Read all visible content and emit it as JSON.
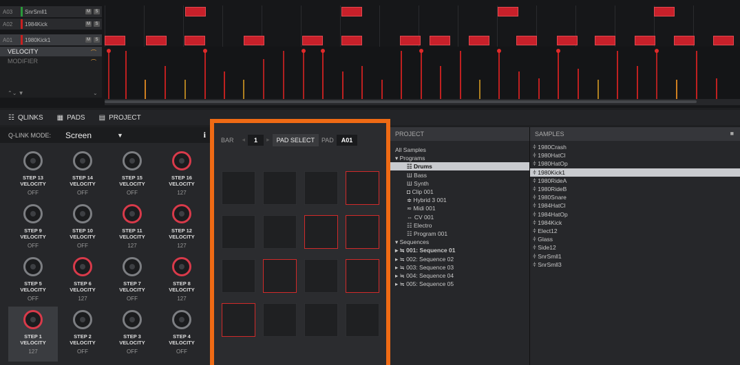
{
  "tracks": [
    {
      "id": "A03",
      "name": "SnrSmll1",
      "color": "#2a9a3a",
      "m": "M",
      "s": "S"
    },
    {
      "id": "A02",
      "name": "1984Kick",
      "color": "#c82020",
      "m": "M",
      "s": "S"
    },
    {
      "id": "A01",
      "name": "1980Kick1",
      "color": "#c82020",
      "m": "M",
      "s": "S"
    }
  ],
  "velocity_panel": {
    "velocity": "VELOCITY",
    "modifier": "MODIFIER",
    "bottom_left": "⌃⌄ ▼",
    "bottom_mid": "⌄"
  },
  "tabs": [
    {
      "label": "QLINKS",
      "icon": "sliders-icon"
    },
    {
      "label": "PADS",
      "icon": "pads-grid-icon"
    },
    {
      "label": "PROJECT",
      "icon": "project-icon"
    }
  ],
  "qlink": {
    "mode_label": "Q-LINK MODE:",
    "mode_value": "Screen",
    "arrow": "▼",
    "info": "i",
    "knobs": [
      {
        "title": "STEP 13",
        "sub": "VELOCITY",
        "value": "OFF",
        "active": false
      },
      {
        "title": "STEP 14",
        "sub": "VELOCITY",
        "value": "OFF",
        "active": false
      },
      {
        "title": "STEP 15",
        "sub": "VELOCITY",
        "value": "OFF",
        "active": false
      },
      {
        "title": "STEP 16",
        "sub": "VELOCITY",
        "value": "127",
        "active": true
      },
      {
        "title": "STEP 9",
        "sub": "VELOCITY",
        "value": "OFF",
        "active": false
      },
      {
        "title": "STEP 10",
        "sub": "VELOCITY",
        "value": "OFF",
        "active": false
      },
      {
        "title": "STEP 11",
        "sub": "VELOCITY",
        "value": "127",
        "active": true
      },
      {
        "title": "STEP 12",
        "sub": "VELOCITY",
        "value": "127",
        "active": true
      },
      {
        "title": "STEP 5",
        "sub": "VELOCITY",
        "value": "OFF",
        "active": false
      },
      {
        "title": "STEP 6",
        "sub": "VELOCITY",
        "value": "127",
        "active": true
      },
      {
        "title": "STEP 7",
        "sub": "VELOCITY",
        "value": "OFF",
        "active": false
      },
      {
        "title": "STEP 8",
        "sub": "VELOCITY",
        "value": "127",
        "active": true
      },
      {
        "title": "STEP 1",
        "sub": "VELOCITY",
        "value": "127",
        "active": true
      },
      {
        "title": "STEP 2",
        "sub": "VELOCITY",
        "value": "OFF",
        "active": false
      },
      {
        "title": "STEP 3",
        "sub": "VELOCITY",
        "value": "OFF",
        "active": false
      },
      {
        "title": "STEP 4",
        "sub": "VELOCITY",
        "value": "OFF",
        "active": false
      }
    ]
  },
  "pads": {
    "bar_label": "BAR",
    "bar_value": "1",
    "pad_select": "PAD SELECT",
    "pad_label": "PAD",
    "pad_value": "A01",
    "lit": [
      false,
      false,
      false,
      true,
      false,
      false,
      true,
      true,
      false,
      true,
      false,
      true,
      true,
      false,
      false,
      false
    ]
  },
  "project": {
    "header": "PROJECT",
    "items": [
      {
        "text": "All Samples",
        "indent": 0
      },
      {
        "text": "▾ Programs",
        "indent": 0
      },
      {
        "text": "☷ Drums",
        "indent": 1,
        "selected": true
      },
      {
        "text": "Ш Bass",
        "indent": 1
      },
      {
        "text": "Ш Synth",
        "indent": 1
      },
      {
        "text": "◘ Clip 001",
        "indent": 1
      },
      {
        "text": "≑ Hybrid 3 001",
        "indent": 1
      },
      {
        "text": "≂ Midi 001",
        "indent": 1
      },
      {
        "text": "⇔ CV 001",
        "indent": 1
      },
      {
        "text": "☷ Electro",
        "indent": 1
      },
      {
        "text": "☷ Program 001",
        "indent": 1
      },
      {
        "text": "▾ Sequences",
        "indent": 0
      },
      {
        "text": "▸   ≒ 001: Sequence 01",
        "indent": 0,
        "bold": true
      },
      {
        "text": "▸   ≒ 002: Sequence 02",
        "indent": 0
      },
      {
        "text": "▸   ≒ 003: Sequence 03",
        "indent": 0
      },
      {
        "text": "▸   ≒ 004: Sequence 04",
        "indent": 0
      },
      {
        "text": "▸   ≒ 005: Sequence 05",
        "indent": 0
      }
    ]
  },
  "samples": {
    "header": "SAMPLES",
    "trash": "🗑",
    "items": [
      "1980Crash",
      "1980HatCl",
      "1980HatOp",
      "1980Kick1",
      "1980RideA",
      "1980RideB",
      "1980Snare",
      "1984HatCl",
      "1984HatOp",
      "1984Kick",
      "Elect12",
      "Glass",
      "Side12",
      "SnrSmll1",
      "SnrSmll3"
    ],
    "selected_index": 3,
    "item_prefix": "⫩"
  }
}
